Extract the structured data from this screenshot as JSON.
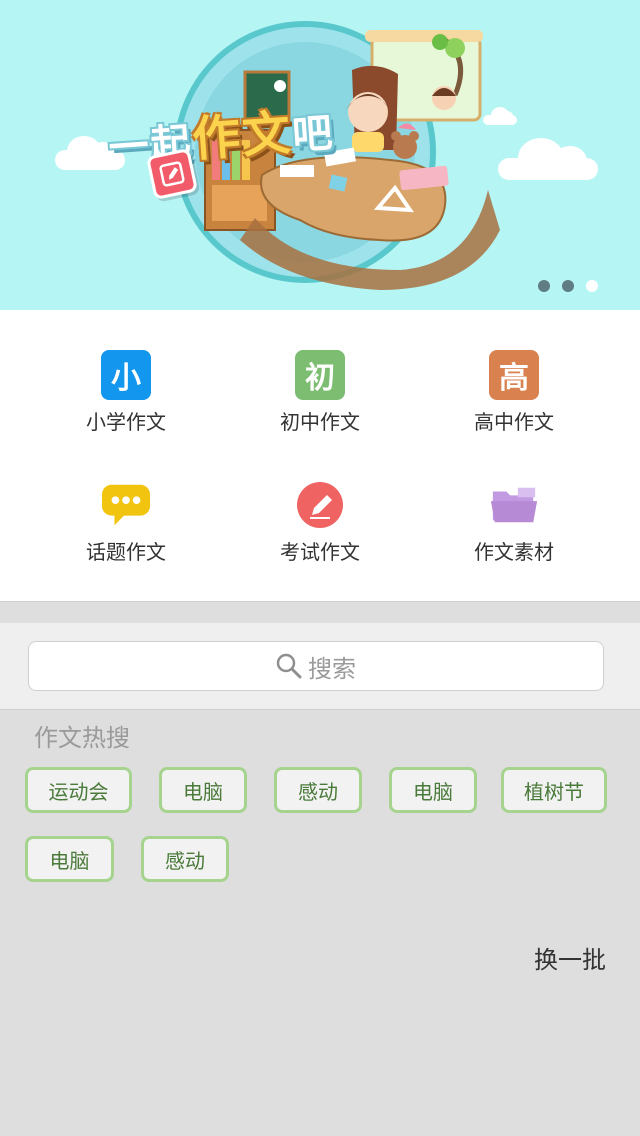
{
  "banner": {
    "title_part1": "一起",
    "title_highlight": "作文",
    "title_part2": "吧",
    "page_count": 3,
    "active_page": 3
  },
  "categories": [
    {
      "icon": "xiao-char-icon",
      "glyph": "小",
      "color": "#1296ee",
      "label": "小学作文"
    },
    {
      "icon": "chu-char-icon",
      "glyph": "初",
      "color": "#7cbd72",
      "label": "初中作文"
    },
    {
      "icon": "gao-char-icon",
      "glyph": "高",
      "color": "#d98250",
      "label": "高中作文"
    },
    {
      "icon": "chat-bubble-icon",
      "color": "#f1c40f",
      "label": "话题作文"
    },
    {
      "icon": "pencil-circle-icon",
      "color": "#ef6363",
      "label": "考试作文"
    },
    {
      "icon": "folder-icon",
      "color": "#b78ad6",
      "label": "作文素材"
    }
  ],
  "search": {
    "placeholder": "搜索"
  },
  "hot_search": {
    "title": "作文热搜",
    "tags": [
      "运动会",
      "电脑",
      "感动",
      "电脑",
      "植树节",
      "电脑",
      "感动"
    ],
    "refresh_label": "换一批"
  },
  "colors": {
    "tag_border": "#a6d48e",
    "banner_bg": "#b5f5f4"
  }
}
